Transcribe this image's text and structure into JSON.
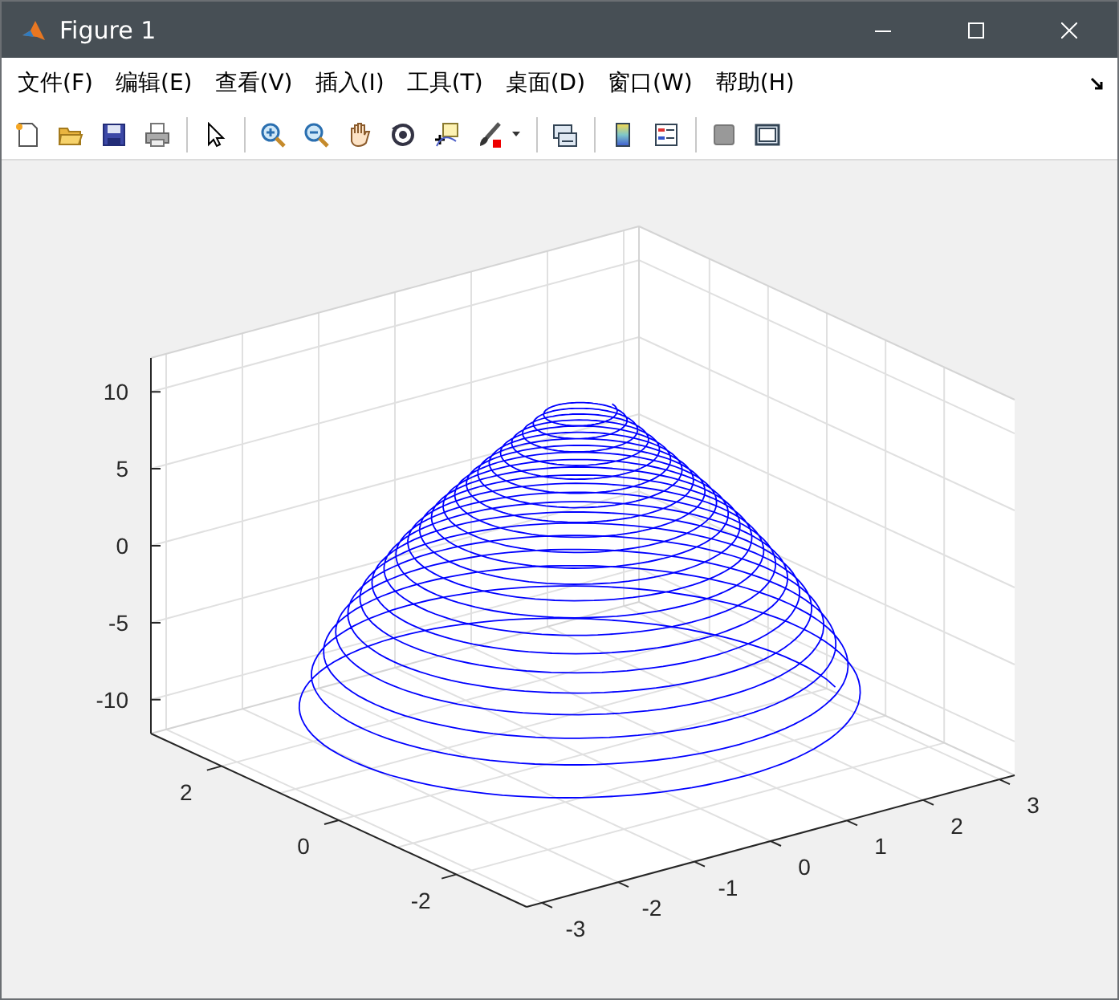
{
  "window": {
    "title": "Figure 1"
  },
  "menu": [
    "文件(F)",
    "编辑(E)",
    "查看(V)",
    "插入(I)",
    "工具(T)",
    "桌面(D)",
    "窗口(W)",
    "帮助(H)"
  ],
  "axes": {
    "z_ticks": [
      "10",
      "5",
      "0",
      "-5",
      "-10"
    ],
    "y_ticks": [
      "2",
      "0",
      "-2"
    ],
    "x_ticks": [
      "-3",
      "-2",
      "-1",
      "0",
      "1",
      "2",
      "3"
    ]
  }
}
